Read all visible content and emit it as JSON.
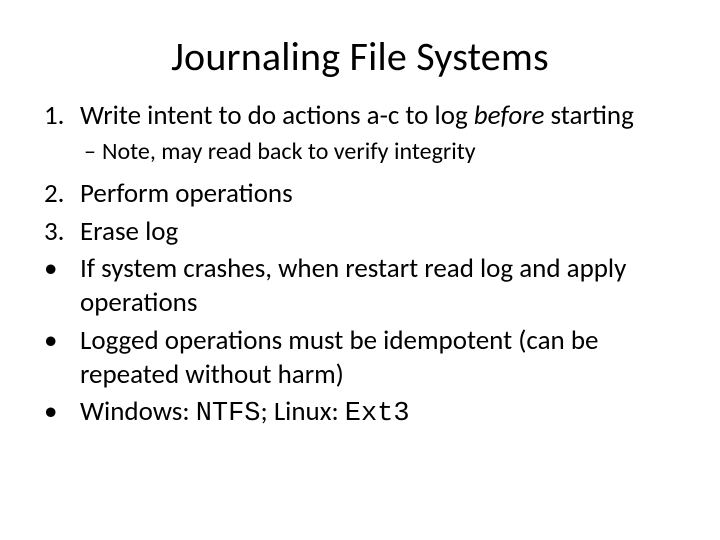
{
  "title": "Journaling File Systems",
  "items": {
    "n1_pre": "Write intent to do actions a-c to log ",
    "n1_em": "before",
    "n1_post": " starting",
    "n1_sub": "Note, may read back to verify integrity",
    "n2": "Perform operations",
    "n3": "Erase log",
    "b1": "If system crashes, when restart read log and apply operations",
    "b2": "Logged operations must be idempotent (can be repeated without harm)",
    "b3_pre": "Windows: ",
    "b3_m1": "NTFS",
    "b3_mid": "; Linux: ",
    "b3_m2": "Ext3"
  },
  "markers": {
    "m1": "1.",
    "m2": "2.",
    "m3": "3.",
    "dash": "–",
    "dot": "•"
  }
}
